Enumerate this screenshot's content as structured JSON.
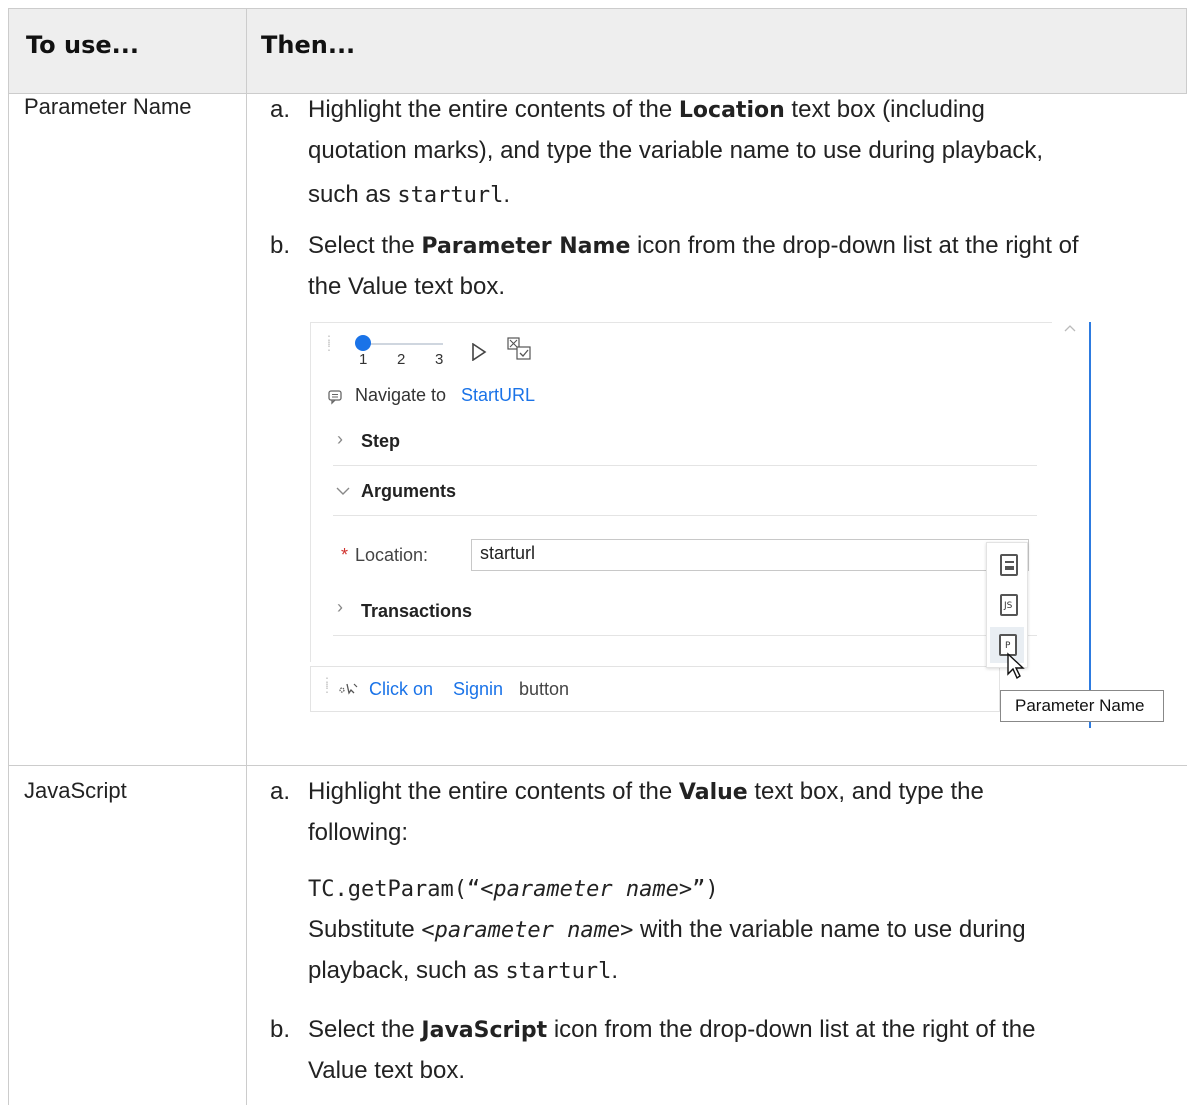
{
  "table": {
    "col1_header": "To use...",
    "col2_header": "Then..."
  },
  "rows": [
    {
      "label": "Parameter Name",
      "step_a": {
        "letter": "a.",
        "t1": "Highlight the entire contents of the ",
        "b1": "Location",
        "t2": " text box (including",
        "line2": "quotation marks), and type the variable name to use during playback,",
        "t3": "such as ",
        "code": "starturl",
        "t4": "."
      },
      "step_b": {
        "letter": "b.",
        "t1": "Select the ",
        "b1": "Parameter Name",
        "t2": " icon from the drop-down list at the right of",
        "line2": "the Value text box."
      }
    },
    {
      "label": "JavaScript",
      "step_a": {
        "letter": "a.",
        "t1": "Highlight the entire contents of the ",
        "b1": "Value",
        "t2": " text box, and type the",
        "line2": "following:",
        "code_prefix": "TC.getParam(“",
        "code_italic": "<parameter name>",
        "code_suffix": "”)",
        "sub_t1": "Substitute ",
        "sub_italic": "<parameter name>",
        "sub_t2": " with the variable name to use during",
        "sub_t3": "playback, such as ",
        "sub_code": "starturl",
        "sub_t4": "."
      },
      "step_b": {
        "letter": "b.",
        "t1": "Select the ",
        "b1": "JavaScript",
        "t2": " icon from the drop-down list at the right of the",
        "line2": "Value text box."
      }
    }
  ],
  "screenshot": {
    "slider_labels": [
      "1",
      "2",
      "3"
    ],
    "nav_prefix": "Navigate to",
    "nav_link": "StartURL",
    "section_step": "Step",
    "section_arguments": "Arguments",
    "required_mark": "*",
    "location_label": "Location:",
    "location_value": "starturl",
    "section_transactions": "Transactions",
    "click_prefix": "Click on",
    "click_link": "Signin",
    "click_suffix": "button",
    "tooltip": "Parameter Name",
    "accent_color": "#1a73e8"
  }
}
